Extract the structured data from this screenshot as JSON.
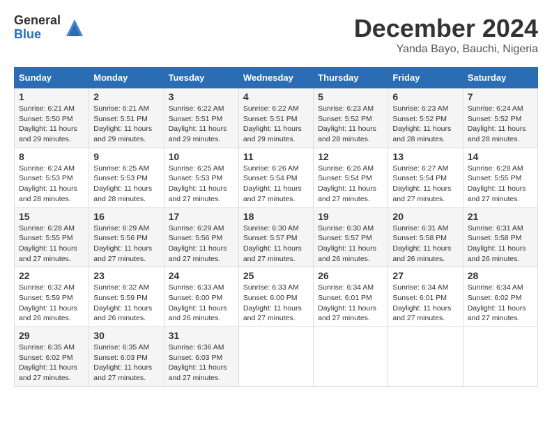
{
  "logo": {
    "general": "General",
    "blue": "Blue"
  },
  "title": "December 2024",
  "location": "Yanda Bayo, Bauchi, Nigeria",
  "days_of_week": [
    "Sunday",
    "Monday",
    "Tuesday",
    "Wednesday",
    "Thursday",
    "Friday",
    "Saturday"
  ],
  "weeks": [
    [
      {
        "day": "1",
        "info": "Sunrise: 6:21 AM\nSunset: 5:50 PM\nDaylight: 11 hours\nand 29 minutes."
      },
      {
        "day": "2",
        "info": "Sunrise: 6:21 AM\nSunset: 5:51 PM\nDaylight: 11 hours\nand 29 minutes."
      },
      {
        "day": "3",
        "info": "Sunrise: 6:22 AM\nSunset: 5:51 PM\nDaylight: 11 hours\nand 29 minutes."
      },
      {
        "day": "4",
        "info": "Sunrise: 6:22 AM\nSunset: 5:51 PM\nDaylight: 11 hours\nand 29 minutes."
      },
      {
        "day": "5",
        "info": "Sunrise: 6:23 AM\nSunset: 5:52 PM\nDaylight: 11 hours\nand 28 minutes."
      },
      {
        "day": "6",
        "info": "Sunrise: 6:23 AM\nSunset: 5:52 PM\nDaylight: 11 hours\nand 28 minutes."
      },
      {
        "day": "7",
        "info": "Sunrise: 6:24 AM\nSunset: 5:52 PM\nDaylight: 11 hours\nand 28 minutes."
      }
    ],
    [
      {
        "day": "8",
        "info": "Sunrise: 6:24 AM\nSunset: 5:53 PM\nDaylight: 11 hours\nand 28 minutes."
      },
      {
        "day": "9",
        "info": "Sunrise: 6:25 AM\nSunset: 5:53 PM\nDaylight: 11 hours\nand 28 minutes."
      },
      {
        "day": "10",
        "info": "Sunrise: 6:25 AM\nSunset: 5:53 PM\nDaylight: 11 hours\nand 27 minutes."
      },
      {
        "day": "11",
        "info": "Sunrise: 6:26 AM\nSunset: 5:54 PM\nDaylight: 11 hours\nand 27 minutes."
      },
      {
        "day": "12",
        "info": "Sunrise: 6:26 AM\nSunset: 5:54 PM\nDaylight: 11 hours\nand 27 minutes."
      },
      {
        "day": "13",
        "info": "Sunrise: 6:27 AM\nSunset: 5:54 PM\nDaylight: 11 hours\nand 27 minutes."
      },
      {
        "day": "14",
        "info": "Sunrise: 6:28 AM\nSunset: 5:55 PM\nDaylight: 11 hours\nand 27 minutes."
      }
    ],
    [
      {
        "day": "15",
        "info": "Sunrise: 6:28 AM\nSunset: 5:55 PM\nDaylight: 11 hours\nand 27 minutes."
      },
      {
        "day": "16",
        "info": "Sunrise: 6:29 AM\nSunset: 5:56 PM\nDaylight: 11 hours\nand 27 minutes."
      },
      {
        "day": "17",
        "info": "Sunrise: 6:29 AM\nSunset: 5:56 PM\nDaylight: 11 hours\nand 27 minutes."
      },
      {
        "day": "18",
        "info": "Sunrise: 6:30 AM\nSunset: 5:57 PM\nDaylight: 11 hours\nand 27 minutes."
      },
      {
        "day": "19",
        "info": "Sunrise: 6:30 AM\nSunset: 5:57 PM\nDaylight: 11 hours\nand 26 minutes."
      },
      {
        "day": "20",
        "info": "Sunrise: 6:31 AM\nSunset: 5:58 PM\nDaylight: 11 hours\nand 26 minutes."
      },
      {
        "day": "21",
        "info": "Sunrise: 6:31 AM\nSunset: 5:58 PM\nDaylight: 11 hours\nand 26 minutes."
      }
    ],
    [
      {
        "day": "22",
        "info": "Sunrise: 6:32 AM\nSunset: 5:59 PM\nDaylight: 11 hours\nand 26 minutes."
      },
      {
        "day": "23",
        "info": "Sunrise: 6:32 AM\nSunset: 5:59 PM\nDaylight: 11 hours\nand 26 minutes."
      },
      {
        "day": "24",
        "info": "Sunrise: 6:33 AM\nSunset: 6:00 PM\nDaylight: 11 hours\nand 26 minutes."
      },
      {
        "day": "25",
        "info": "Sunrise: 6:33 AM\nSunset: 6:00 PM\nDaylight: 11 hours\nand 27 minutes."
      },
      {
        "day": "26",
        "info": "Sunrise: 6:34 AM\nSunset: 6:01 PM\nDaylight: 11 hours\nand 27 minutes."
      },
      {
        "day": "27",
        "info": "Sunrise: 6:34 AM\nSunset: 6:01 PM\nDaylight: 11 hours\nand 27 minutes."
      },
      {
        "day": "28",
        "info": "Sunrise: 6:34 AM\nSunset: 6:02 PM\nDaylight: 11 hours\nand 27 minutes."
      }
    ],
    [
      {
        "day": "29",
        "info": "Sunrise: 6:35 AM\nSunset: 6:02 PM\nDaylight: 11 hours\nand 27 minutes."
      },
      {
        "day": "30",
        "info": "Sunrise: 6:35 AM\nSunset: 6:03 PM\nDaylight: 11 hours\nand 27 minutes."
      },
      {
        "day": "31",
        "info": "Sunrise: 6:36 AM\nSunset: 6:03 PM\nDaylight: 11 hours\nand 27 minutes."
      },
      null,
      null,
      null,
      null
    ]
  ]
}
